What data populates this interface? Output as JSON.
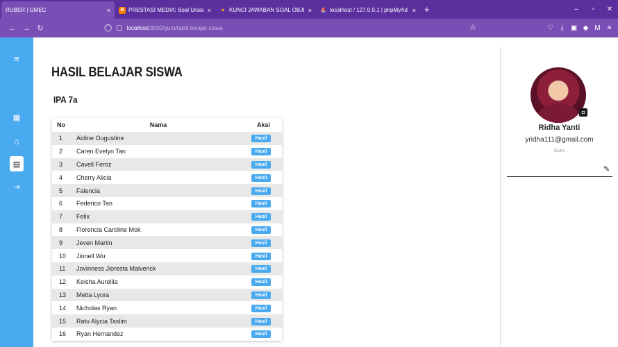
{
  "browser": {
    "tabs": [
      {
        "title": "RUBER | GMEC",
        "icon": "page-icon",
        "active": true
      },
      {
        "title": "PRESTASI MEDIA: Soal Uraian IP",
        "icon": "blogger-icon",
        "color": "#f57c00"
      },
      {
        "title": "KUNCI JAWABAN SOAL OBJEK",
        "icon": "drive-icon",
        "color": "#fbbc04"
      },
      {
        "title": "localhost / 127.0.0.1 | phpMyAd",
        "icon": "phpmyadmin-icon",
        "color": "#f29111"
      }
    ],
    "close_symbol": "×",
    "new_tab_symbol": "+",
    "url_host": "localhost",
    "url_rest": ":8000/guru/hasil-belajar-siswa",
    "window_controls": [
      "–",
      "▫",
      "✕"
    ]
  },
  "sidebar": {
    "color": "#4aaaf0",
    "items": [
      {
        "icon": "menu-icon",
        "glyph": "≡"
      },
      {
        "icon": "grid-icon",
        "glyph": "▦"
      },
      {
        "icon": "home-icon",
        "glyph": "⌂"
      },
      {
        "icon": "book-icon",
        "glyph": "▤",
        "active": true
      },
      {
        "icon": "logout-icon",
        "glyph": "⇥"
      }
    ]
  },
  "page": {
    "title": "HASIL BELAJAR SISWA",
    "class_name": "IPA 7a"
  },
  "table": {
    "headers": {
      "no": "No",
      "nama": "Nama",
      "aksi": "Aksi"
    },
    "action_label": "Hasil",
    "rows": [
      {
        "no": "1",
        "nama": "Aidine Ougustine"
      },
      {
        "no": "2",
        "nama": "Caren Evelyn Tan"
      },
      {
        "no": "3",
        "nama": "Cavell Feroz"
      },
      {
        "no": "4",
        "nama": "Cherry Alicia"
      },
      {
        "no": "5",
        "nama": "Falencia"
      },
      {
        "no": "6",
        "nama": "Federico Tan"
      },
      {
        "no": "7",
        "nama": "Felix"
      },
      {
        "no": "8",
        "nama": "Florencia Caroline Mok"
      },
      {
        "no": "9",
        "nama": "Jeven Martin"
      },
      {
        "no": "10",
        "nama": "Jionell Wu"
      },
      {
        "no": "11",
        "nama": "Jovinness Jioresta Malverick"
      },
      {
        "no": "12",
        "nama": "Keisha Aurellia"
      },
      {
        "no": "13",
        "nama": "Metta Lyora"
      },
      {
        "no": "14",
        "nama": "Nicholas Ryan"
      },
      {
        "no": "15",
        "nama": "Ratu Alycia Taslim"
      },
      {
        "no": "16",
        "nama": "Ryan Hernandez"
      }
    ]
  },
  "profile": {
    "name": "Ridha Yanti",
    "email": "yridha111@gmail.com",
    "role": "Guru"
  }
}
